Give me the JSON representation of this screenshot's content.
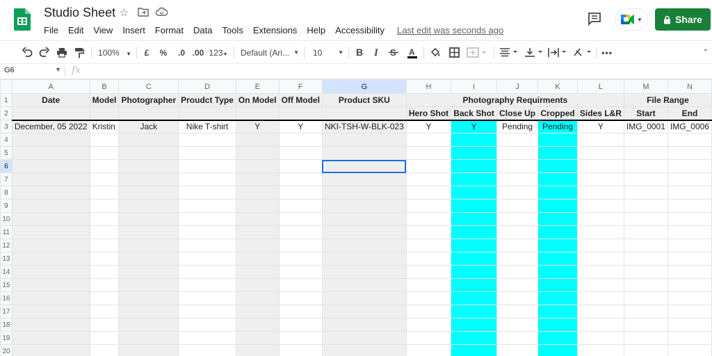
{
  "title": "Studio Sheet",
  "menu": [
    "File",
    "Edit",
    "View",
    "Insert",
    "Format",
    "Data",
    "Tools",
    "Extensions",
    "Help",
    "Accessibility"
  ],
  "last_edit": "Last edit was seconds ago",
  "share_label": "Share",
  "toolbar": {
    "zoom": "100%",
    "currency": "£",
    "percent": "%",
    "dec_decrease": ".0",
    "dec_increase": ".00",
    "more_formats": "123",
    "font": "Default (Ari...",
    "font_size": "10"
  },
  "formula_bar": {
    "name_box": "G6",
    "fx": "fx",
    "value": ""
  },
  "columns": [
    "A",
    "B",
    "C",
    "D",
    "E",
    "F",
    "G",
    "H",
    "I",
    "J",
    "K",
    "L",
    "M",
    "N"
  ],
  "row_numbers": [
    "1",
    "2",
    "3",
    "4",
    "5",
    "6",
    "7",
    "8",
    "9",
    "10",
    "11",
    "12",
    "13",
    "14",
    "15",
    "16",
    "17",
    "18",
    "19",
    "20"
  ],
  "header_row1": {
    "date": "Date",
    "model": "Model",
    "photographer": "Photographer",
    "product_type": "Proudct Type",
    "on_model": "On Model",
    "off_model": "Off Model",
    "sku": "Product SKU",
    "photo_req": "Photography Requirments",
    "file_range": "File Range"
  },
  "header_row2": {
    "hero": "Hero Shot",
    "back": "Back Shot",
    "close": "Close Up",
    "cropped": "Cropped",
    "sides": "Sides L&R",
    "start": "Start",
    "end": "End"
  },
  "row3": {
    "date": "December, 05 2022",
    "model": "Kristin",
    "photographer": "Jack",
    "product_type": "Nike T-shirt",
    "on_model": "Y",
    "off_model": "Y",
    "sku": "NKI-TSH-W-BLK-023",
    "hero": "Y",
    "back": "Y",
    "close": "Pending",
    "cropped": "Pending",
    "sides": "Y",
    "start": "IMG_0001",
    "end": "IMG_0006"
  },
  "selected_cell": "G6",
  "colors": {
    "share": "#188038",
    "cyan": "#00ffff",
    "gray": "#efefef",
    "selection": "#1a73e8"
  }
}
